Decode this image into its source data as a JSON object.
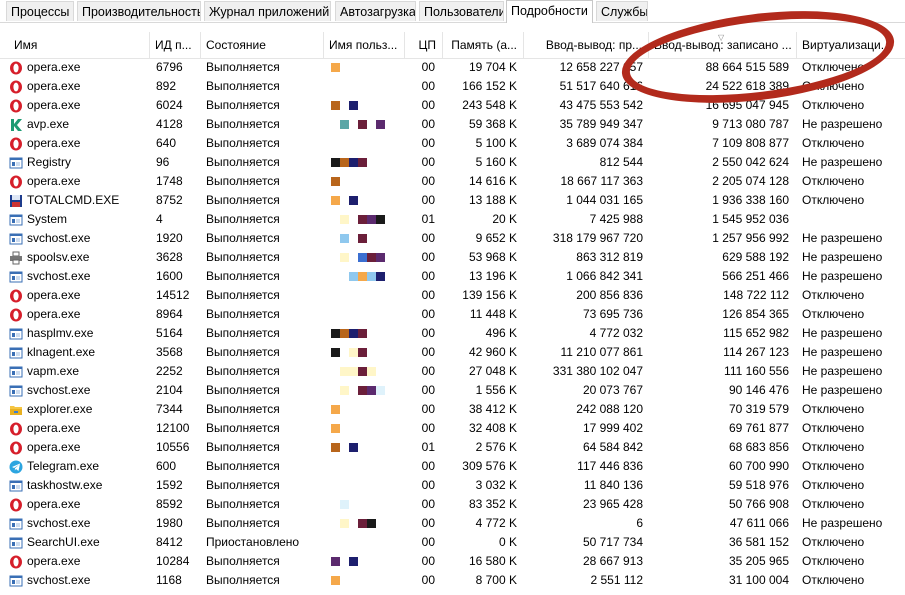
{
  "tabs": [
    "Процессы",
    "Производительность",
    "Журнал приложений",
    "Автозагрузка",
    "Пользователи",
    "Подробности",
    "Службы"
  ],
  "active_tab": "Подробности",
  "columns": [
    "Имя",
    "ИД п...",
    "Состояние",
    "Имя польз...",
    "ЦП",
    "Память (а...",
    "Ввод-вывод: пр...",
    "Ввод-вывод: записано ...",
    "Виртуализаци..."
  ],
  "colors": {
    "opera": "#d61f2b",
    "annotation": "#b22a1c",
    "blk_orange": "#f5a84a",
    "blk_brown": "#b8651b",
    "blk_navy": "#1d1f6e",
    "blk_teal": "#5aa6a6",
    "blk_maroon": "#6b1f3a",
    "blk_purple": "#5b2a6e",
    "blk_black": "#1a1a1a",
    "blk_ltblue": "#8fc8ee",
    "blk_yellow": "#fff6c8",
    "blk_paleblue": "#dff2fb",
    "blk_blue": "#3b6fd1"
  },
  "processes": [
    {
      "name": "opera.exe",
      "pid": "6796",
      "state": "Выполняется",
      "cpu": "00",
      "mem": "19 704 K",
      "read": "12 658 227 057",
      "write": "88 664 515 589",
      "virt": "Отключено",
      "icon": "opera-icon",
      "user": [
        "orange"
      ]
    },
    {
      "name": "opera.exe",
      "pid": "892",
      "state": "Выполняется",
      "cpu": "00",
      "mem": "166 152 K",
      "read": "51 517 640 616",
      "write": "24 522 618 389",
      "virt": "Отключено",
      "icon": "opera-icon",
      "user": []
    },
    {
      "name": "opera.exe",
      "pid": "6024",
      "state": "Выполняется",
      "cpu": "00",
      "mem": "243 548 K",
      "read": "43 475 553 542",
      "write": "16 695 047 945",
      "virt": "Отключено",
      "icon": "opera-icon",
      "user": [
        "brown",
        "",
        "navy"
      ]
    },
    {
      "name": "avp.exe",
      "pid": "4128",
      "state": "Выполняется",
      "cpu": "00",
      "mem": "59 368 K",
      "read": "35 789 949 347",
      "write": "9 713 080 787",
      "virt": "Не разрешено",
      "icon": "kaspersky-icon",
      "user": [
        "",
        "teal",
        "",
        "maroon",
        "",
        "purple"
      ]
    },
    {
      "name": "opera.exe",
      "pid": "640",
      "state": "Выполняется",
      "cpu": "00",
      "mem": "5 100 K",
      "read": "3 689 074 384",
      "write": "7 109 808 877",
      "virt": "Отключено",
      "icon": "opera-icon",
      "user": []
    },
    {
      "name": "Registry",
      "pid": "96",
      "state": "Выполняется",
      "cpu": "00",
      "mem": "5 160 K",
      "read": "812 544",
      "write": "2 550 042 624",
      "virt": "Не разрешено",
      "icon": "window-icon",
      "user": [
        "black",
        "brown",
        "navy",
        "maroon"
      ]
    },
    {
      "name": "opera.exe",
      "pid": "1748",
      "state": "Выполняется",
      "cpu": "00",
      "mem": "14 616 K",
      "read": "18 667 117 363",
      "write": "2 205 074 128",
      "virt": "Отключено",
      "icon": "opera-icon",
      "user": [
        "brown"
      ]
    },
    {
      "name": "TOTALCMD.EXE",
      "pid": "8752",
      "state": "Выполняется",
      "cpu": "00",
      "mem": "13 188 K",
      "read": "1 044 031 165",
      "write": "1 936 338 160",
      "virt": "Отключено",
      "icon": "floppy-icon",
      "user": [
        "orange",
        "",
        "navy"
      ]
    },
    {
      "name": "System",
      "pid": "4",
      "state": "Выполняется",
      "cpu": "01",
      "mem": "20 K",
      "read": "7 425 988",
      "write": "1 545 952 036",
      "virt": "",
      "icon": "window-icon",
      "user": [
        "",
        "yellow",
        "",
        "maroon",
        "purple",
        "black"
      ]
    },
    {
      "name": "svchost.exe",
      "pid": "1920",
      "state": "Выполняется",
      "cpu": "00",
      "mem": "9 652 K",
      "read": "318 179 967 720",
      "write": "1 257 956 992",
      "virt": "Не разрешено",
      "icon": "window-icon",
      "user": [
        "",
        "ltblue",
        "",
        "maroon"
      ]
    },
    {
      "name": "spoolsv.exe",
      "pid": "3628",
      "state": "Выполняется",
      "cpu": "00",
      "mem": "53 968 K",
      "read": "863 312 819",
      "write": "629 588 192",
      "virt": "Не разрешено",
      "icon": "printer-icon",
      "user": [
        "",
        "yellow",
        "",
        "blue",
        "maroon",
        "purple"
      ]
    },
    {
      "name": "svchost.exe",
      "pid": "1600",
      "state": "Выполняется",
      "cpu": "00",
      "mem": "13 196 K",
      "read": "1 066 842 341",
      "write": "566 251 466",
      "virt": "Не разрешено",
      "icon": "window-icon",
      "user": [
        "",
        "",
        "ltblue",
        "orange",
        "ltblue",
        "navy"
      ]
    },
    {
      "name": "opera.exe",
      "pid": "14512",
      "state": "Выполняется",
      "cpu": "00",
      "mem": "139 156 K",
      "read": "200 856 836",
      "write": "148 722 112",
      "virt": "Отключено",
      "icon": "opera-icon",
      "user": []
    },
    {
      "name": "opera.exe",
      "pid": "8964",
      "state": "Выполняется",
      "cpu": "00",
      "mem": "11 448 K",
      "read": "73 695 736",
      "write": "126 854 365",
      "virt": "Отключено",
      "icon": "opera-icon",
      "user": []
    },
    {
      "name": "hasplmv.exe",
      "pid": "5164",
      "state": "Выполняется",
      "cpu": "00",
      "mem": "496 K",
      "read": "4 772 032",
      "write": "115 652 982",
      "virt": "Не разрешено",
      "icon": "window-icon",
      "user": [
        "black",
        "brown",
        "navy",
        "maroon"
      ]
    },
    {
      "name": "klnagent.exe",
      "pid": "3568",
      "state": "Выполняется",
      "cpu": "00",
      "mem": "42 960 K",
      "read": "11 210 077 861",
      "write": "114 267 123",
      "virt": "Не разрешено",
      "icon": "window-icon",
      "user": [
        "black",
        "",
        "yellow",
        "maroon"
      ]
    },
    {
      "name": "vapm.exe",
      "pid": "2252",
      "state": "Выполняется",
      "cpu": "00",
      "mem": "27 048 K",
      "read": "331 380 102 047",
      "write": "111 160 556",
      "virt": "Не разрешено",
      "icon": "window-icon",
      "user": [
        "",
        "yellow",
        "yellow",
        "maroon",
        "yellow"
      ]
    },
    {
      "name": "svchost.exe",
      "pid": "2104",
      "state": "Выполняется",
      "cpu": "00",
      "mem": "1 556 K",
      "read": "20 073 767",
      "write": "90 146 476",
      "virt": "Не разрешено",
      "icon": "window-icon",
      "user": [
        "",
        "yellow",
        "",
        "maroon",
        "purple",
        "paleblue"
      ]
    },
    {
      "name": "explorer.exe",
      "pid": "7344",
      "state": "Выполняется",
      "cpu": "00",
      "mem": "38 412 K",
      "read": "242 088 120",
      "write": "70 319 579",
      "virt": "Отключено",
      "icon": "folder-icon",
      "user": [
        "orange"
      ]
    },
    {
      "name": "opera.exe",
      "pid": "12100",
      "state": "Выполняется",
      "cpu": "00",
      "mem": "32 408 K",
      "read": "17 999 402",
      "write": "69 761 877",
      "virt": "Отключено",
      "icon": "opera-icon",
      "user": [
        "orange"
      ]
    },
    {
      "name": "opera.exe",
      "pid": "10556",
      "state": "Выполняется",
      "cpu": "01",
      "mem": "2 576 K",
      "read": "64 584 842",
      "write": "68 683 856",
      "virt": "Отключено",
      "icon": "opera-icon",
      "user": [
        "brown",
        "",
        "navy"
      ]
    },
    {
      "name": "Telegram.exe",
      "pid": "600",
      "state": "Выполняется",
      "cpu": "00",
      "mem": "309 576 K",
      "read": "117 446 836",
      "write": "60 700 990",
      "virt": "Отключено",
      "icon": "telegram-icon",
      "user": []
    },
    {
      "name": "taskhostw.exe",
      "pid": "1592",
      "state": "Выполняется",
      "cpu": "00",
      "mem": "3 032 K",
      "read": "11 840 136",
      "write": "59 518 976",
      "virt": "Отключено",
      "icon": "window-icon",
      "user": []
    },
    {
      "name": "opera.exe",
      "pid": "8592",
      "state": "Выполняется",
      "cpu": "00",
      "mem": "83 352 K",
      "read": "23 965 428",
      "write": "50 766 908",
      "virt": "Отключено",
      "icon": "opera-icon",
      "user": [
        "",
        "paleblue"
      ]
    },
    {
      "name": "svchost.exe",
      "pid": "1980",
      "state": "Выполняется",
      "cpu": "00",
      "mem": "4 772 K",
      "read": "6",
      "write": "47 611 066",
      "virt": "Не разрешено",
      "icon": "window-icon",
      "user": [
        "",
        "yellow",
        "",
        "maroon",
        "black"
      ]
    },
    {
      "name": "SearchUI.exe",
      "pid": "8412",
      "state": "Приостановлено",
      "cpu": "00",
      "mem": "0 K",
      "read": "50 717 734",
      "write": "36 581 152",
      "virt": "Отключено",
      "icon": "window-icon",
      "user": []
    },
    {
      "name": "opera.exe",
      "pid": "10284",
      "state": "Выполняется",
      "cpu": "00",
      "mem": "16 580 K",
      "read": "28 667 913",
      "write": "35 205 965",
      "virt": "Отключено",
      "icon": "opera-icon",
      "user": [
        "purple",
        "",
        "navy"
      ]
    },
    {
      "name": "svchost.exe",
      "pid": "1168",
      "state": "Выполняется",
      "cpu": "00",
      "mem": "8 700 K",
      "read": "2 551 112",
      "write": "31 100 004",
      "virt": "Отключено",
      "icon": "window-icon",
      "user": [
        "orange"
      ]
    }
  ]
}
